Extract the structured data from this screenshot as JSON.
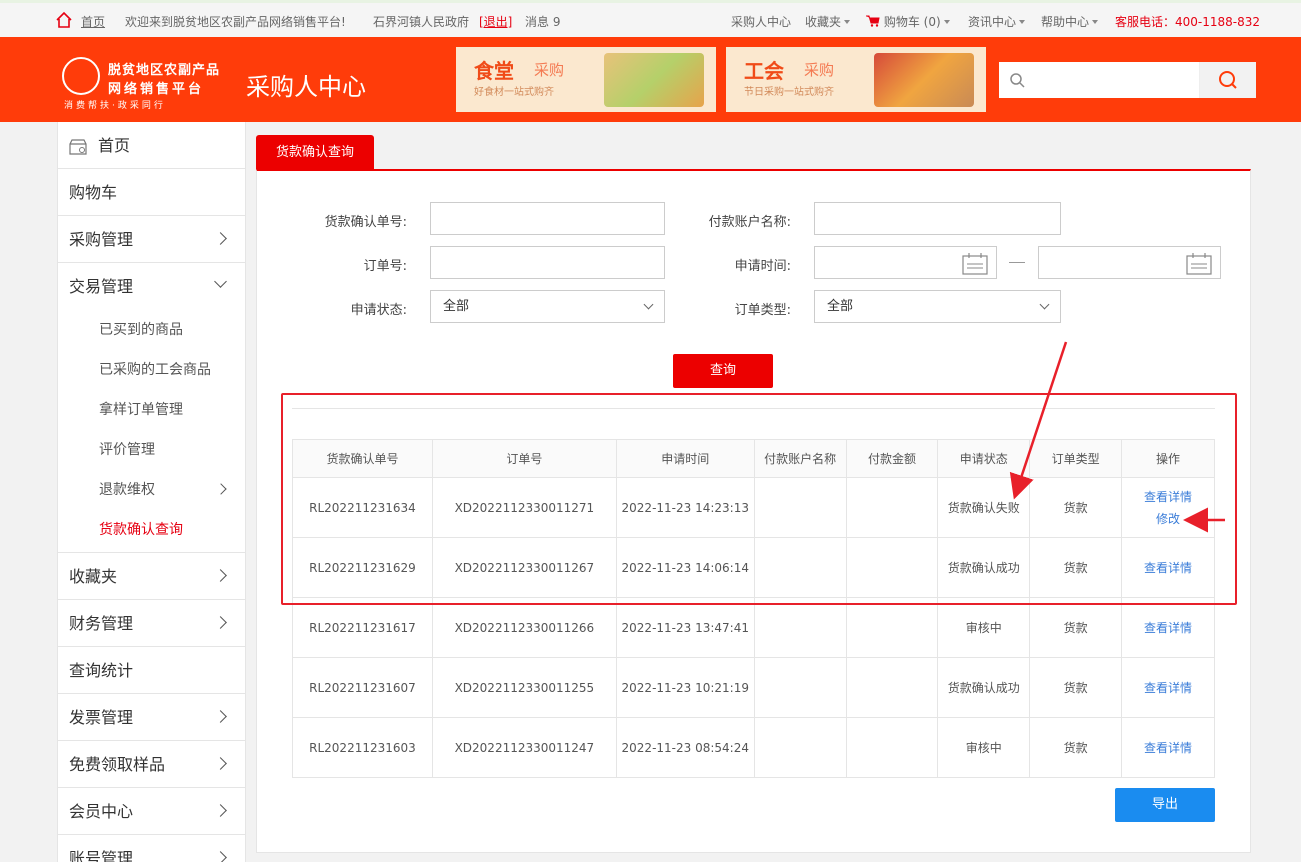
{
  "topbar": {
    "home": "首页",
    "welcome": "欢迎来到脱贫地区农副产品网络销售平台!",
    "org": "石界河镇人民政府",
    "logout": "[退出]",
    "messages_label": "消息",
    "messages_count": "9",
    "buyer_center": "采购人中心",
    "favorites": "收藏夹",
    "cart_label": "购物车",
    "cart_count": "(0)",
    "news": "资讯中心",
    "help": "帮助中心",
    "hotline": "客服电话：400-1188-832"
  },
  "header": {
    "logo_line1": "脱贫地区农副产品",
    "logo_line2": "网络销售平台",
    "logo_line3": "消费帮扶·政采同行",
    "title": "采购人中心",
    "banner1": {
      "title": "食堂",
      "sub_title": "采购",
      "slogan": "好食材一站式购齐"
    },
    "banner2": {
      "title": "工会",
      "sub_title": "采购",
      "slogan": "节日采购一站式购齐"
    },
    "search_placeholder": ""
  },
  "sidebar": {
    "items": [
      {
        "label": "首页"
      },
      {
        "label": "购物车"
      },
      {
        "label": "采购管理"
      },
      {
        "label": "交易管理"
      },
      {
        "label": "收藏夹"
      },
      {
        "label": "财务管理"
      },
      {
        "label": "查询统计"
      },
      {
        "label": "发票管理"
      },
      {
        "label": "免费领取样品"
      },
      {
        "label": "会员中心"
      },
      {
        "label": "账号管理"
      }
    ],
    "sub_items": [
      {
        "label": "已买到的商品"
      },
      {
        "label": "已采购的工会商品"
      },
      {
        "label": "拿样订单管理"
      },
      {
        "label": "评价管理"
      },
      {
        "label": "退款维权"
      },
      {
        "label": "货款确认查询"
      }
    ]
  },
  "main": {
    "tab": "货款确认查询",
    "form": {
      "confirm_no_label": "货款确认单号:",
      "payer_name_label": "付款账户名称:",
      "order_no_label": "订单号:",
      "apply_time_label": "申请时间:",
      "status_label": "申请状态:",
      "status_value": "全部",
      "order_type_label": "订单类型:",
      "order_type_value": "全部"
    },
    "query_button": "查询",
    "export_button": "导出",
    "table": {
      "headers": [
        "货款确认单号",
        "订单号",
        "申请时间",
        "付款账户名称",
        "付款金额",
        "申请状态",
        "订单类型",
        "操作"
      ],
      "rows": [
        {
          "confirm_no": "RL202211231634",
          "order_no": "XD2022112330011271",
          "time": "2022-11-23 14:23:13",
          "payer": "",
          "amount": "",
          "status": "货款确认失败",
          "type": "货款",
          "detail": "查看详情",
          "edit": "修改"
        },
        {
          "confirm_no": "RL202211231629",
          "order_no": "XD2022112330011267",
          "time": "2022-11-23 14:06:14",
          "payer": "",
          "amount": "",
          "status": "货款确认成功",
          "type": "货款",
          "detail": "查看详情",
          "edit": ""
        },
        {
          "confirm_no": "RL202211231617",
          "order_no": "XD2022112330011266",
          "time": "2022-11-23 13:47:41",
          "payer": "",
          "amount": "",
          "status": "审核中",
          "type": "货款",
          "detail": "查看详情",
          "edit": ""
        },
        {
          "confirm_no": "RL202211231607",
          "order_no": "XD2022112330011255",
          "time": "2022-11-23 10:21:19",
          "payer": "",
          "amount": "",
          "status": "货款确认成功",
          "type": "货款",
          "detail": "查看详情",
          "edit": ""
        },
        {
          "confirm_no": "RL202211231603",
          "order_no": "XD2022112330011247",
          "time": "2022-11-23 08:54:24",
          "payer": "",
          "amount": "",
          "status": "审核中",
          "type": "货款",
          "detail": "查看详情",
          "edit": ""
        }
      ]
    }
  },
  "colors": {
    "brand_red": "#ff3c0a",
    "tab_red": "#ec0000",
    "link_blue": "#3b7dd8",
    "export_blue": "#1a8cf0"
  }
}
